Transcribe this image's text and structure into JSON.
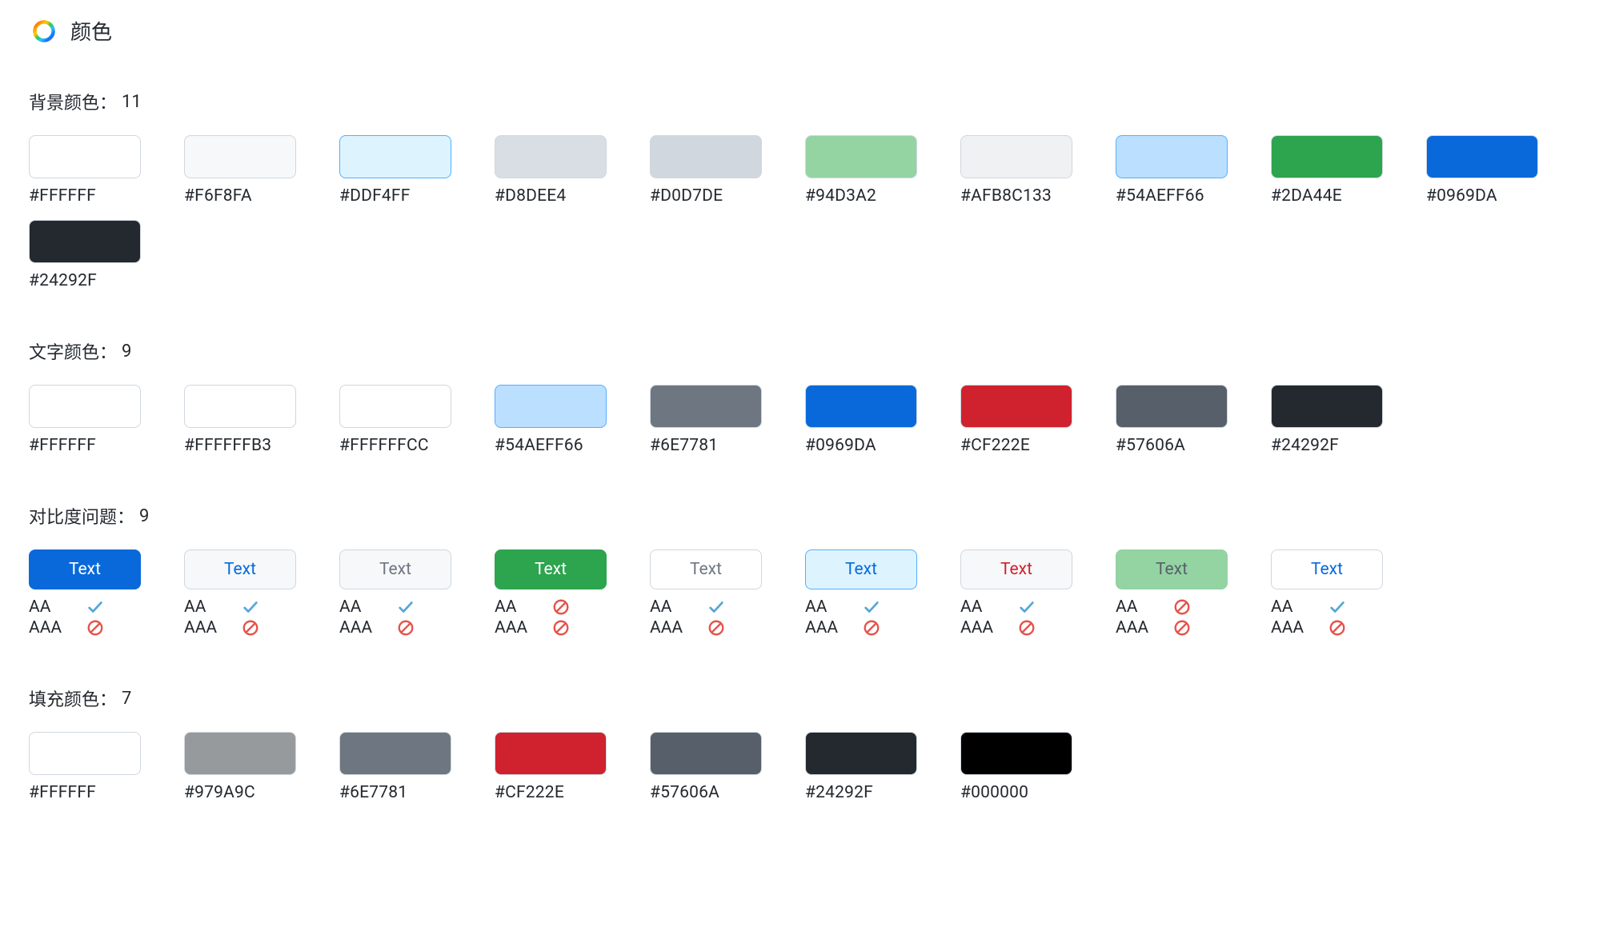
{
  "header": {
    "title": "颜色"
  },
  "sections": {
    "background": {
      "label": "背景颜色：",
      "count": "11",
      "swatches": [
        {
          "color": "#FFFFFF",
          "label": "#FFFFFF"
        },
        {
          "color": "#F6F8FA",
          "label": "#F6F8FA"
        },
        {
          "color": "#DDF4FF",
          "label": "#DDF4FF",
          "border": "#54AEFF"
        },
        {
          "color": "#D8DEE4",
          "label": "#D8DEE4"
        },
        {
          "color": "#D0D7DE",
          "label": "#D0D7DE"
        },
        {
          "color": "#94D3A2",
          "label": "#94D3A2"
        },
        {
          "color": "#AFB8C133",
          "label": "#AFB8C133"
        },
        {
          "color": "#54AEFF66",
          "label": "#54AEFF66",
          "border": "#54AEFF"
        },
        {
          "color": "#2DA44E",
          "label": "#2DA44E"
        },
        {
          "color": "#0969DA",
          "label": "#0969DA"
        },
        {
          "color": "#24292F",
          "label": "#24292F"
        }
      ]
    },
    "text": {
      "label": "文字颜色：",
      "count": "9",
      "swatches": [
        {
          "color": "#FFFFFF",
          "label": "#FFFFFF"
        },
        {
          "color": "#FFFFFFB3",
          "label": "#FFFFFFB3"
        },
        {
          "color": "#FFFFFFCC",
          "label": "#FFFFFFCC"
        },
        {
          "color": "#54AEFF66",
          "label": "#54AEFF66",
          "border": "#54AEFF"
        },
        {
          "color": "#6E7781",
          "label": "#6E7781"
        },
        {
          "color": "#0969DA",
          "label": "#0969DA"
        },
        {
          "color": "#CF222E",
          "label": "#CF222E"
        },
        {
          "color": "#57606A",
          "label": "#57606A"
        },
        {
          "color": "#24292F",
          "label": "#24292F"
        }
      ]
    },
    "contrast": {
      "label": "对比度问题：",
      "count": "9",
      "sample_text": "Text",
      "ratings_labels": {
        "aa": "AA",
        "aaa": "AAA"
      },
      "items": [
        {
          "bg": "#0969DA",
          "fg": "#FFFFFF",
          "border": "#0969DA",
          "aa": "pass",
          "aaa": "fail"
        },
        {
          "bg": "#F6F8FA",
          "fg": "#0969DA",
          "aa": "pass",
          "aaa": "fail"
        },
        {
          "bg": "#F6F8FA",
          "fg": "#6E7781",
          "aa": "pass",
          "aaa": "fail"
        },
        {
          "bg": "#2DA44E",
          "fg": "#FFFFFF",
          "border": "#2DA44E",
          "aa": "fail",
          "aaa": "fail"
        },
        {
          "bg": "#FFFFFF",
          "fg": "#6E7781",
          "aa": "pass",
          "aaa": "fail"
        },
        {
          "bg": "#DDF4FF",
          "fg": "#0969DA",
          "border": "#54AEFF",
          "aa": "pass",
          "aaa": "fail"
        },
        {
          "bg": "#F6F8FA",
          "fg": "#CF222E",
          "aa": "pass",
          "aaa": "fail"
        },
        {
          "bg": "#94D3A2",
          "fg": "#57606A",
          "border": "#94D3A2",
          "aa": "fail",
          "aaa": "fail"
        },
        {
          "bg": "#FFFFFF",
          "fg": "#0969DA",
          "aa": "pass",
          "aaa": "fail"
        }
      ]
    },
    "fill": {
      "label": "填充颜色：",
      "count": "7",
      "swatches": [
        {
          "color": "#FFFFFF",
          "label": "#FFFFFF"
        },
        {
          "color": "#979A9C",
          "label": "#979A9C"
        },
        {
          "color": "#6E7781",
          "label": "#6E7781"
        },
        {
          "color": "#CF222E",
          "label": "#CF222E"
        },
        {
          "color": "#57606A",
          "label": "#57606A"
        },
        {
          "color": "#24292F",
          "label": "#24292F"
        },
        {
          "color": "#000000",
          "label": "#000000"
        }
      ]
    }
  }
}
